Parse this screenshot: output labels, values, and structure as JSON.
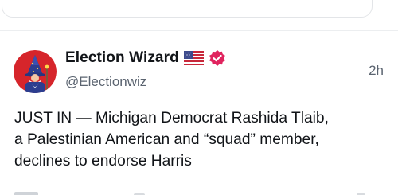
{
  "post": {
    "display_name": "Election Wizard",
    "handle": "@Electionwiz",
    "timestamp": "2h",
    "body_lines": [
      "JUST IN — Michigan Democrat Rashida Tlaib,",
      "a Palestinian American and “squad” member,",
      "declines to endorse Harris"
    ],
    "flag_icon": "us-flag-icon",
    "verified_icon": "verified-badge-icon",
    "avatar_icon": "wizard-avatar-icon"
  },
  "colors": {
    "avatar_bg": "#d6252b",
    "verified": "#e0245e",
    "secondary_text": "#5b6470",
    "divider": "#eceef0"
  }
}
